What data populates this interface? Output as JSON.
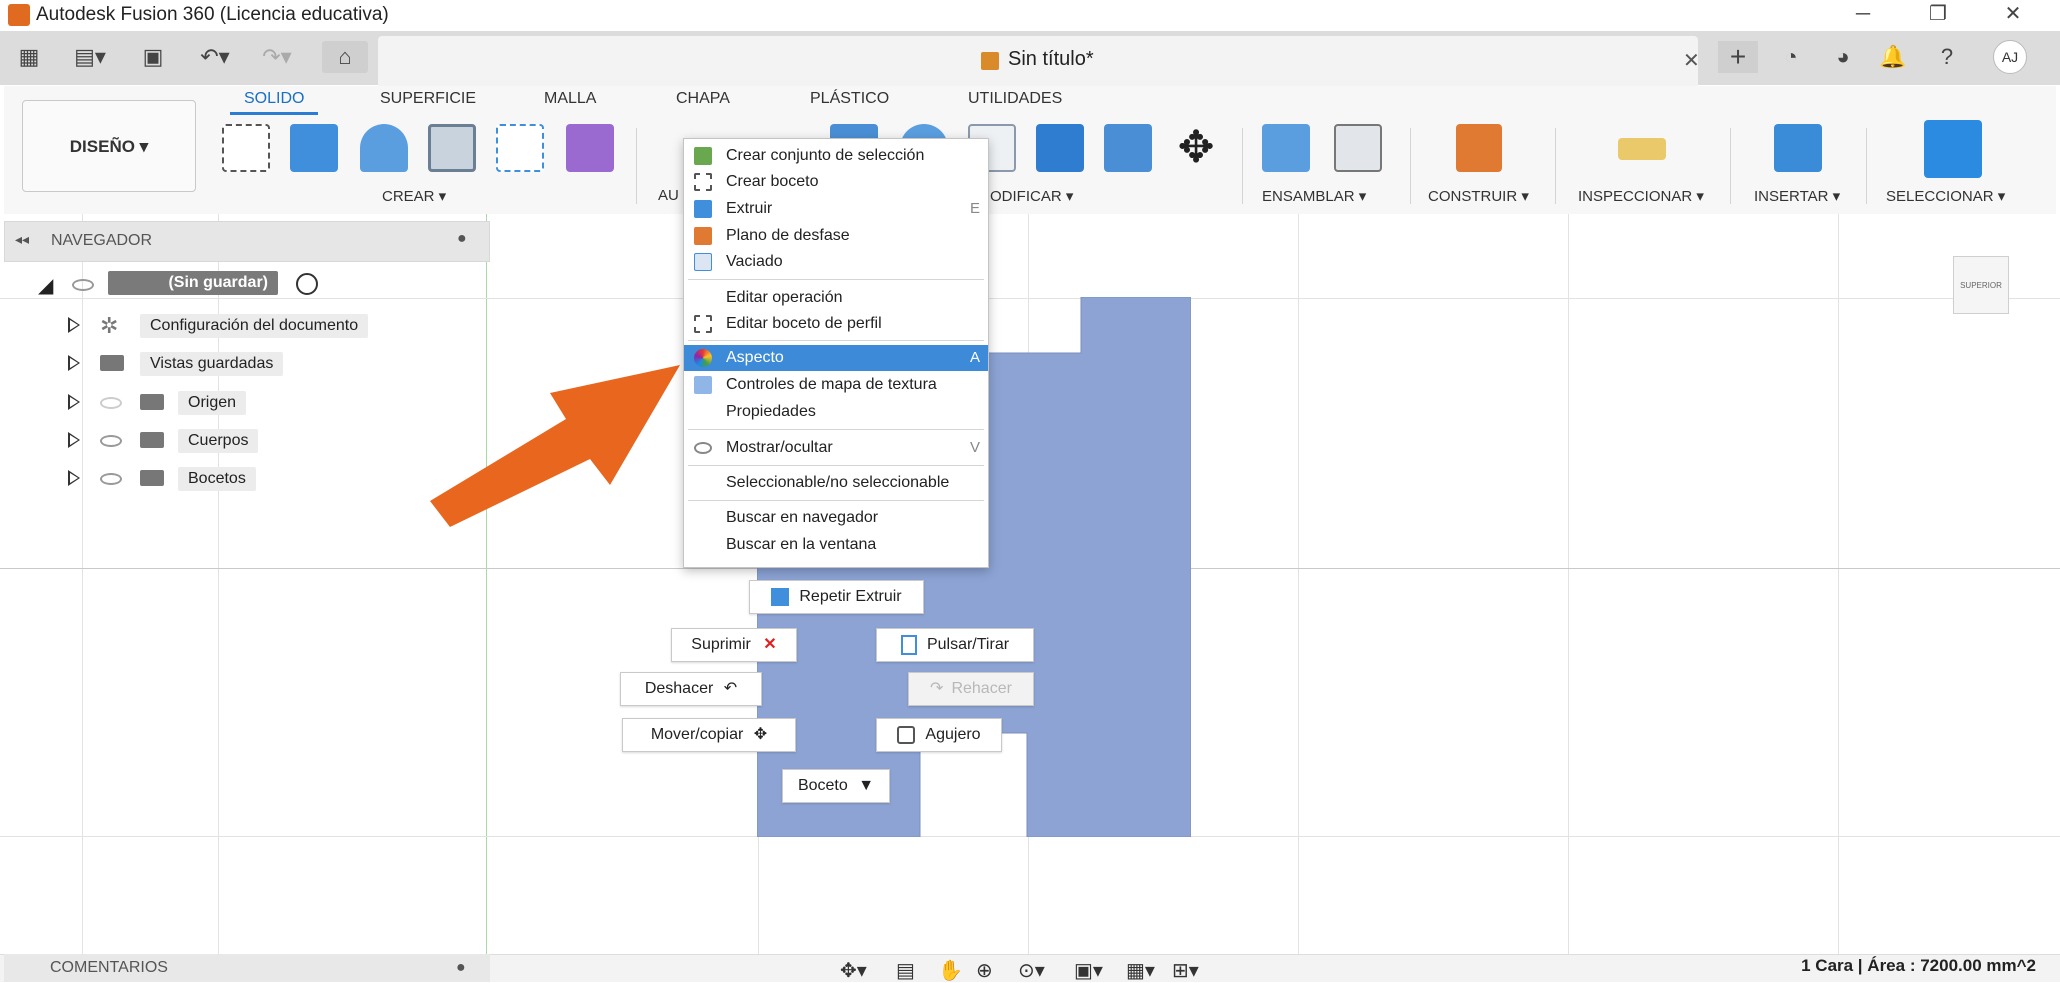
{
  "window": {
    "title": "Autodesk Fusion 360 (Licencia educativa)",
    "min": "─",
    "max": "❐",
    "close": "✕"
  },
  "document": {
    "tab_title": "Sin título*",
    "close": "✕",
    "add": "+"
  },
  "user": {
    "initials": "AJ"
  },
  "workspace": {
    "label": "DISEÑO ▾"
  },
  "ribbon_tabs": [
    "SOLIDO",
    "SUPERFICIE",
    "MALLA",
    "CHAPA",
    "PLÁSTICO",
    "UTILIDADES"
  ],
  "ribbon_groups": {
    "crear": "CREAR ▾",
    "aut": "AU",
    "modificar": "ODIFICAR ▾",
    "ensamblar": "ENSAMBLAR ▾",
    "construir": "CONSTRUIR ▾",
    "inspeccionar": "INSPECCIONAR ▾",
    "insertar": "INSERTAR ▾",
    "seleccionar": "SELECCIONAR ▾"
  },
  "navigator": {
    "title": "NAVEGADOR",
    "root": "(Sin guardar)",
    "items": [
      "Configuración del documento",
      "Vistas guardadas",
      "Origen",
      "Cuerpos",
      "Bocetos"
    ]
  },
  "context_menu": {
    "items": [
      {
        "label": "Crear conjunto de selección",
        "shortcut": ""
      },
      {
        "label": "Crear boceto",
        "shortcut": ""
      },
      {
        "label": "Extruir",
        "shortcut": "E"
      },
      {
        "label": "Plano de desfase",
        "shortcut": ""
      },
      {
        "label": "Vaciado",
        "shortcut": ""
      },
      {
        "label": "Editar operación",
        "shortcut": ""
      },
      {
        "label": "Editar boceto de perfil",
        "shortcut": ""
      },
      {
        "label": "Aspecto",
        "shortcut": "A"
      },
      {
        "label": "Controles de mapa de textura",
        "shortcut": ""
      },
      {
        "label": "Propiedades",
        "shortcut": ""
      },
      {
        "label": "Mostrar/ocultar",
        "shortcut": "V"
      },
      {
        "label": "Seleccionable/no seleccionable",
        "shortcut": ""
      },
      {
        "label": "Buscar en navegador",
        "shortcut": ""
      },
      {
        "label": "Buscar en la ventana",
        "shortcut": ""
      }
    ],
    "highlighted": "Aspecto"
  },
  "marking_menu": {
    "repeat": "Repetir Extruir",
    "delete": "Suprimir",
    "press_pull": "Pulsar/Tirar",
    "undo": "Deshacer",
    "redo": "Rehacer",
    "move": "Mover/copiar",
    "hole": "Agujero",
    "sketch": "Boceto"
  },
  "viewcube": {
    "label": "SUPERIOR"
  },
  "comments": {
    "label": "COMENTARIOS"
  },
  "status": {
    "text": "1 Cara | Área : 7200.00 mm^2"
  },
  "colors": {
    "accent": "#2b7cd3",
    "body": "#8ca3d4",
    "arrow": "#e8661e",
    "highlight": "#3c8ad8"
  }
}
